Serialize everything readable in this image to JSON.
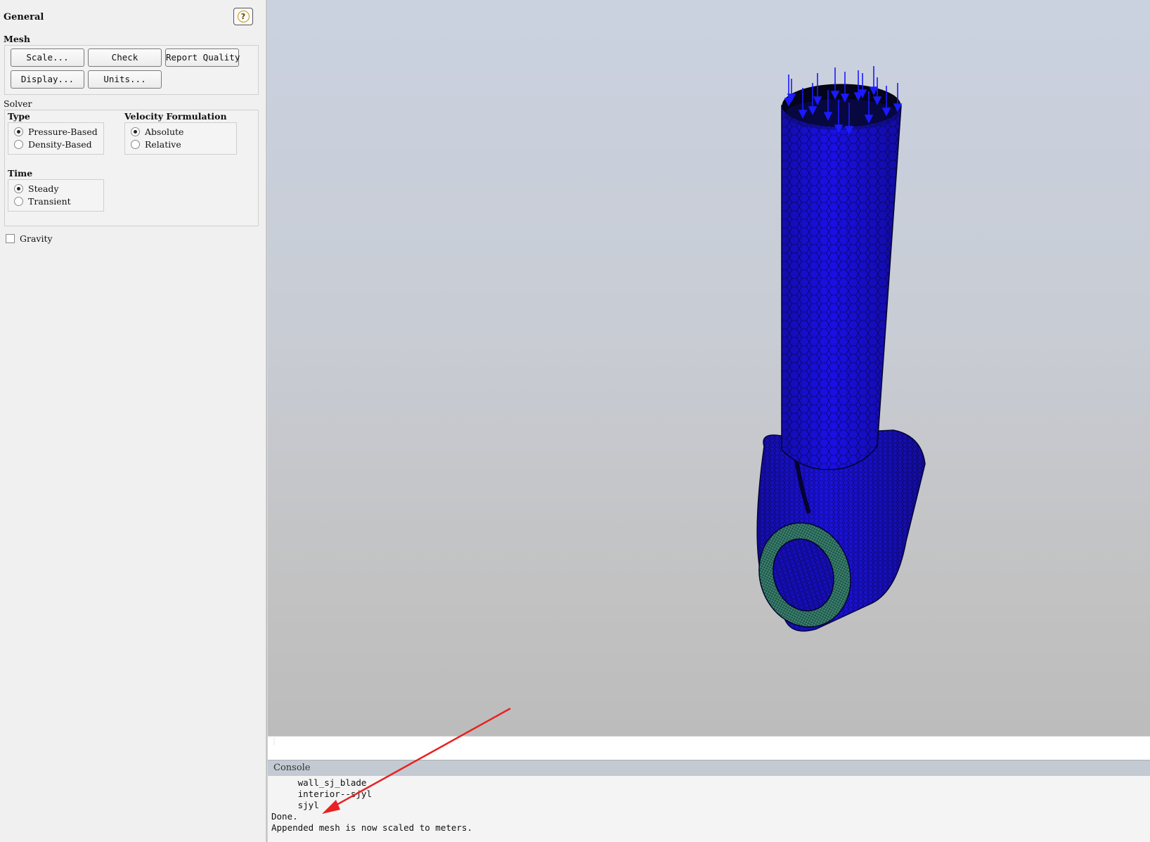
{
  "panel": {
    "title": "General",
    "help_icon": "?",
    "mesh": {
      "title": "Mesh",
      "buttons": {
        "scale": "Scale...",
        "check": "Check",
        "report_quality": "Report Quality",
        "display": "Display...",
        "units": "Units..."
      }
    },
    "solver": {
      "title": "Solver",
      "type": {
        "title": "Type",
        "options": [
          "Pressure-Based",
          "Density-Based"
        ],
        "selected": "Pressure-Based"
      },
      "velocity": {
        "title": "Velocity Formulation",
        "options": [
          "Absolute",
          "Relative"
        ],
        "selected": "Absolute"
      },
      "time": {
        "title": "Time",
        "options": [
          "Steady",
          "Transient"
        ],
        "selected": "Steady"
      }
    },
    "gravity": {
      "label": "Gravity",
      "checked": false
    }
  },
  "viewport": {
    "mesh_color": "#1a10e6",
    "inlet_ring_color": "#1c5a4a",
    "arrow_color": "#1a1aff"
  },
  "console": {
    "title": "Console",
    "lines": [
      "     wall_sj_blade",
      "     interior--sjyl",
      "     sjyl",
      "Done.",
      "Appended mesh is now scaled to meters."
    ]
  },
  "annotation": {
    "arrow_color": "#e82222"
  }
}
